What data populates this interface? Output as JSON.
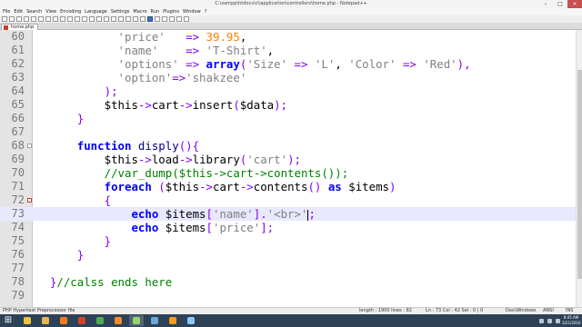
{
  "window": {
    "title": "C:\\xampp\\htdocs\\ci\\application\\controllers\\home.php - Notepad++",
    "controls": [
      "–",
      "□",
      "×"
    ]
  },
  "menu": [
    "File",
    "Edit",
    "Search",
    "View",
    "Encoding",
    "Language",
    "Settings",
    "Macro",
    "Run",
    "Plugins",
    "Window",
    "?"
  ],
  "tab": {
    "label": "home.php"
  },
  "editor": {
    "lines": [
      {
        "n": "60",
        "parts": [
          [
            "",
            "            "
          ],
          [
            "s",
            "'price'"
          ],
          [
            "",
            "   "
          ],
          [
            "o",
            "=>"
          ],
          [
            "",
            " "
          ],
          [
            "n",
            "39.95"
          ],
          [
            "",
            ","
          ]
        ]
      },
      {
        "n": "61",
        "parts": [
          [
            "",
            "            "
          ],
          [
            "s",
            "'name'"
          ],
          [
            "",
            "    "
          ],
          [
            "o",
            "=>"
          ],
          [
            "",
            " "
          ],
          [
            "s",
            "'T-Shirt'"
          ],
          [
            "",
            ","
          ]
        ]
      },
      {
        "n": "62",
        "parts": [
          [
            "",
            "            "
          ],
          [
            "s",
            "'options'"
          ],
          [
            "",
            " "
          ],
          [
            "o",
            "=>"
          ],
          [
            "",
            " "
          ],
          [
            "k",
            "array"
          ],
          [
            "o",
            "("
          ],
          [
            "s",
            "'Size'"
          ],
          [
            "",
            " "
          ],
          [
            "o",
            "=>"
          ],
          [
            "",
            " "
          ],
          [
            "s",
            "'L'"
          ],
          [
            "",
            ", "
          ],
          [
            "s",
            "'Color'"
          ],
          [
            "",
            " "
          ],
          [
            "o",
            "=>"
          ],
          [
            "",
            " "
          ],
          [
            "s",
            "'Red'"
          ],
          [
            "o",
            "),"
          ]
        ]
      },
      {
        "n": "63",
        "parts": [
          [
            "",
            "            "
          ],
          [
            "s",
            "'option'"
          ],
          [
            "o",
            "=>"
          ],
          [
            "s",
            "'shakzee'"
          ]
        ]
      },
      {
        "n": "64",
        "parts": [
          [
            "",
            "          "
          ],
          [
            "o",
            ");"
          ]
        ]
      },
      {
        "n": "65",
        "parts": [
          [
            "",
            "          "
          ],
          [
            "",
            "$this"
          ],
          [
            "o",
            "->"
          ],
          [
            "",
            "cart"
          ],
          [
            "o",
            "->"
          ],
          [
            "",
            "insert"
          ],
          [
            "o",
            "("
          ],
          [
            "",
            "$data"
          ],
          [
            "o",
            ");"
          ]
        ]
      },
      {
        "n": "66",
        "parts": [
          [
            "",
            "      "
          ],
          [
            "o",
            "}"
          ]
        ]
      },
      {
        "n": "67",
        "parts": []
      },
      {
        "n": "68",
        "parts": [
          [
            "",
            "      "
          ],
          [
            "k",
            "function"
          ],
          [
            "",
            " "
          ],
          [
            "f",
            "disply"
          ],
          [
            "o",
            "(){"
          ]
        ]
      },
      {
        "n": "69",
        "parts": [
          [
            "",
            "          "
          ],
          [
            "",
            "$this"
          ],
          [
            "o",
            "->"
          ],
          [
            "",
            "load"
          ],
          [
            "o",
            "->"
          ],
          [
            "",
            "library"
          ],
          [
            "o",
            "("
          ],
          [
            "s",
            "'cart'"
          ],
          [
            "o",
            ");"
          ]
        ]
      },
      {
        "n": "70",
        "parts": [
          [
            "",
            "          "
          ],
          [
            "c",
            "//var_dump($this->cart->contents());"
          ]
        ]
      },
      {
        "n": "71",
        "parts": [
          [
            "",
            "          "
          ],
          [
            "k",
            "foreach"
          ],
          [
            "",
            " "
          ],
          [
            "o",
            "("
          ],
          [
            "",
            "$this"
          ],
          [
            "o",
            "->"
          ],
          [
            "",
            "cart"
          ],
          [
            "o",
            "->"
          ],
          [
            "",
            "contents"
          ],
          [
            "o",
            "()"
          ],
          [
            "",
            " "
          ],
          [
            "k",
            "as"
          ],
          [
            "",
            " "
          ],
          [
            "",
            "$items"
          ],
          [
            "o",
            ")"
          ]
        ]
      },
      {
        "n": "72",
        "parts": [
          [
            "",
            "          "
          ],
          [
            "o",
            "{"
          ]
        ]
      },
      {
        "n": "73",
        "parts": [
          [
            "",
            "              "
          ],
          [
            "k",
            "echo"
          ],
          [
            "",
            " "
          ],
          [
            "",
            "$items"
          ],
          [
            "o",
            "["
          ],
          [
            "s",
            "'name'"
          ],
          [
            "o",
            "]."
          ],
          [
            "s",
            "'<br>'"
          ],
          [
            "o",
            ";"
          ]
        ]
      },
      {
        "n": "74",
        "parts": [
          [
            "",
            "              "
          ],
          [
            "k",
            "echo"
          ],
          [
            "",
            " "
          ],
          [
            "",
            "$items"
          ],
          [
            "o",
            "["
          ],
          [
            "s",
            "'price'"
          ],
          [
            "o",
            "];"
          ]
        ]
      },
      {
        "n": "75",
        "parts": [
          [
            "",
            "          "
          ],
          [
            "o",
            "}"
          ]
        ]
      },
      {
        "n": "76",
        "parts": [
          [
            "",
            "      "
          ],
          [
            "o",
            "}"
          ]
        ]
      },
      {
        "n": "77",
        "parts": []
      },
      {
        "n": "78",
        "parts": [
          [
            "",
            "  "
          ],
          [
            "o",
            "}"
          ],
          [
            "c",
            "//calss ends here"
          ]
        ]
      },
      {
        "n": "79",
        "parts": []
      }
    ],
    "current_line": "73",
    "fold_markers": {
      "68": "plain",
      "72": "red"
    }
  },
  "status": {
    "file_type": "PHP Hypertext Preprocessor file",
    "length": "length : 1900   lines : 82",
    "position": "Ln : 73   Col : 42   Sel : 0 | 0",
    "eol": "Dos\\Windows",
    "encoding": "ANSI",
    "mode": "INS"
  },
  "taskbar": {
    "apps": [
      {
        "icon": "ie-icon",
        "color": "#f2c23a"
      },
      {
        "icon": "folder-icon",
        "color": "#e7b84b"
      },
      {
        "icon": "media-player-icon",
        "color": "#ff7b1c"
      },
      {
        "icon": "filezilla-icon",
        "color": "#d9402a"
      },
      {
        "icon": "chrome-icon",
        "color": "#4caf50"
      },
      {
        "icon": "firefox-icon",
        "color": "#ff8a2b"
      },
      {
        "icon": "notepadpp-icon",
        "color": "#9bd36b",
        "active": true
      },
      {
        "icon": "app-icon",
        "color": "#6aa8d8"
      },
      {
        "icon": "vlc-icon",
        "color": "#ff9a1a"
      },
      {
        "icon": "paint-icon",
        "color": "#8ec6ff"
      }
    ],
    "clock": {
      "time": "8:45 AM",
      "date": "3/21/2016"
    }
  }
}
